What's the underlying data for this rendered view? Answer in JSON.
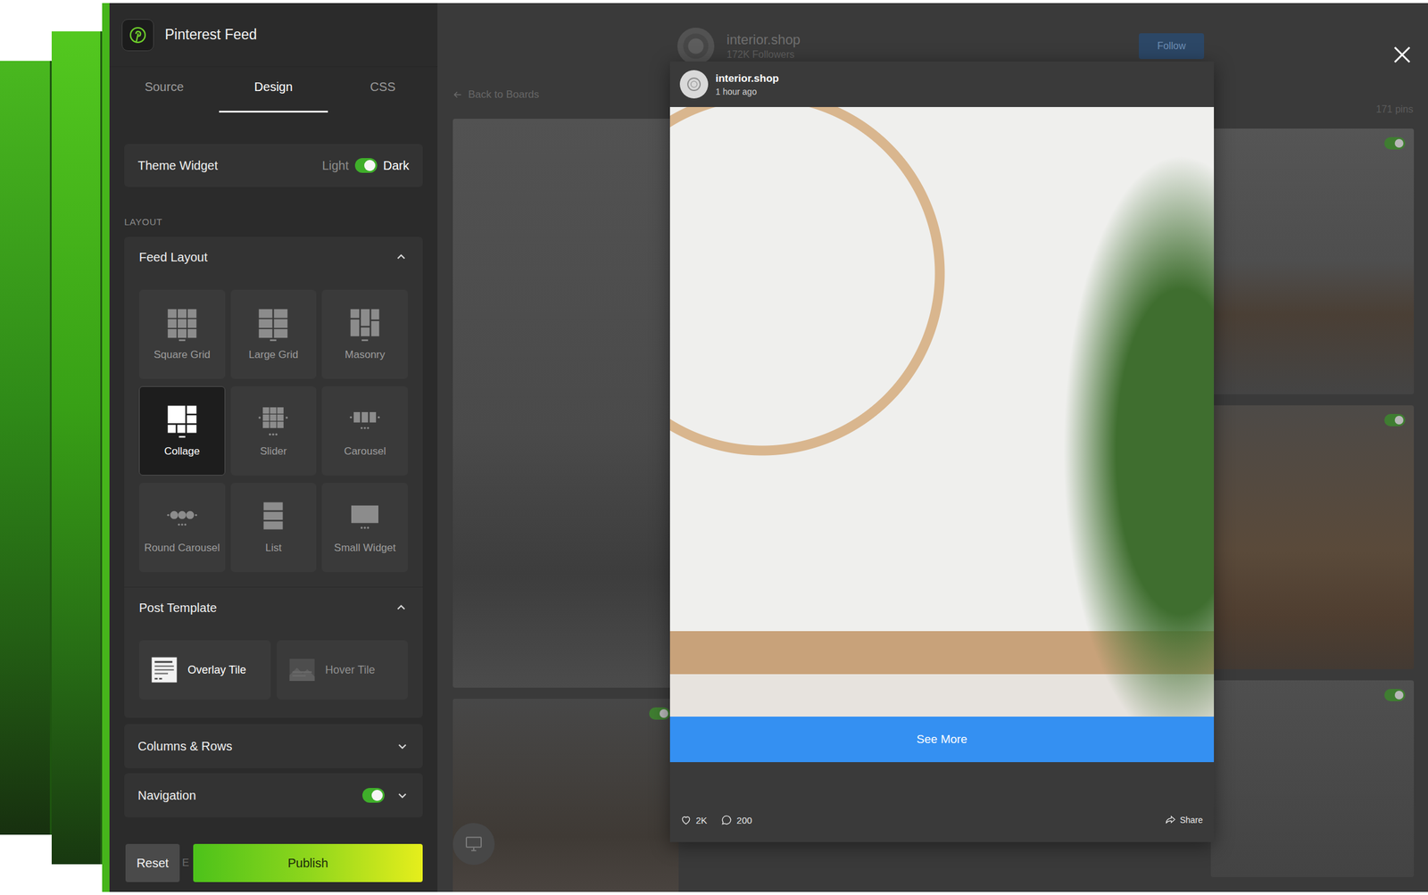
{
  "app": {
    "title": "Pinterest Feed"
  },
  "tabs": [
    {
      "label": "Source",
      "selected": false
    },
    {
      "label": "Design",
      "selected": true
    },
    {
      "label": "CSS",
      "selected": false
    }
  ],
  "theme": {
    "label": "Theme Widget",
    "off_label": "Light",
    "on_label": "Dark",
    "on": true
  },
  "section_label": "LAYOUT",
  "feed_layout": {
    "title": "Feed Layout",
    "expanded": true,
    "options": [
      {
        "label": "Square Grid",
        "kind": "grid",
        "selected": false
      },
      {
        "label": "Large Grid",
        "kind": "large",
        "selected": false
      },
      {
        "label": "Masonry",
        "kind": "masonry",
        "selected": false
      },
      {
        "label": "Collage",
        "kind": "collage",
        "selected": true
      },
      {
        "label": "Slider",
        "kind": "slider",
        "selected": false
      },
      {
        "label": "Carousel",
        "kind": "carousel",
        "selected": false
      },
      {
        "label": "Round Carousel",
        "kind": "round",
        "selected": false
      },
      {
        "label": "List",
        "kind": "list",
        "selected": false
      },
      {
        "label": "Small Widget",
        "kind": "widget",
        "selected": false
      }
    ]
  },
  "post_template": {
    "title": "Post Template",
    "expanded": true,
    "options": [
      {
        "label": "Overlay Tile",
        "kind": "overlay",
        "selected": true
      },
      {
        "label": "Hover Tile",
        "kind": "hover",
        "selected": false
      }
    ]
  },
  "columns_rows": {
    "title": "Columns & Rows",
    "expanded": false
  },
  "navigation": {
    "title": "Navigation",
    "on": true,
    "expanded": false
  },
  "bottom_bar": {
    "reset": "Reset",
    "peek": "E",
    "publish": "Publish"
  },
  "profile": {
    "name": "interior.shop",
    "followers": "172K Followers",
    "follow": "Follow"
  },
  "back_link": "Back to Boards",
  "pin_count": "171 pins",
  "gallery": {
    "columns": [
      {
        "tiles": [
          {
            "kind": "photo"
          },
          {
            "kind": "photo-switch",
            "on": true
          }
        ]
      },
      {
        "tiles": []
      },
      {
        "tiles": [
          {
            "kind": "photo-switch",
            "on": true
          },
          {
            "kind": "photo-switch",
            "on": true
          },
          {
            "kind": "photo-switch",
            "on": true
          }
        ]
      }
    ]
  },
  "post": {
    "author": "interior.shop",
    "time": "1 hour ago",
    "cta": "See More",
    "likes": "2K",
    "comments": "200",
    "share": "Share"
  }
}
